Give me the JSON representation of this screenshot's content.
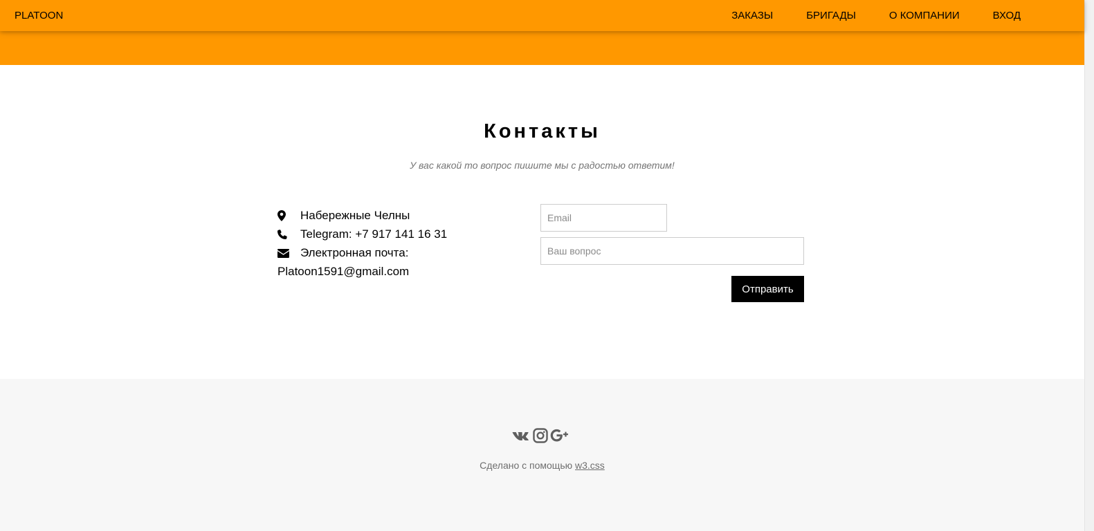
{
  "navbar": {
    "brand": "PLATOON",
    "links": [
      "ЗАКАЗЫ",
      "БРИГАДЫ",
      "О КОМПАНИИ",
      "ВХОД"
    ],
    "color": "#ff9800"
  },
  "contacts": {
    "title": "Контакты",
    "subtitle": "У вас какой то вопрос пишите мы с радостью ответим!",
    "location": "Набережные Челны",
    "phone": "Telegram: +7 917 141 16 31",
    "email_label": "Электронная почта:",
    "email_value": "Platoon1591@gmail.com",
    "icons": [
      "map-marker-icon",
      "phone-icon",
      "envelope-icon"
    ]
  },
  "form": {
    "email_placeholder": "Email",
    "question_placeholder": "Ваш вопрос",
    "send_label": "Отправить"
  },
  "footer": {
    "social_icons": [
      "vk-icon",
      "instagram-icon",
      "google-plus-icon"
    ],
    "made_with": "Сделано с помощью",
    "link_text": "w3.css"
  }
}
